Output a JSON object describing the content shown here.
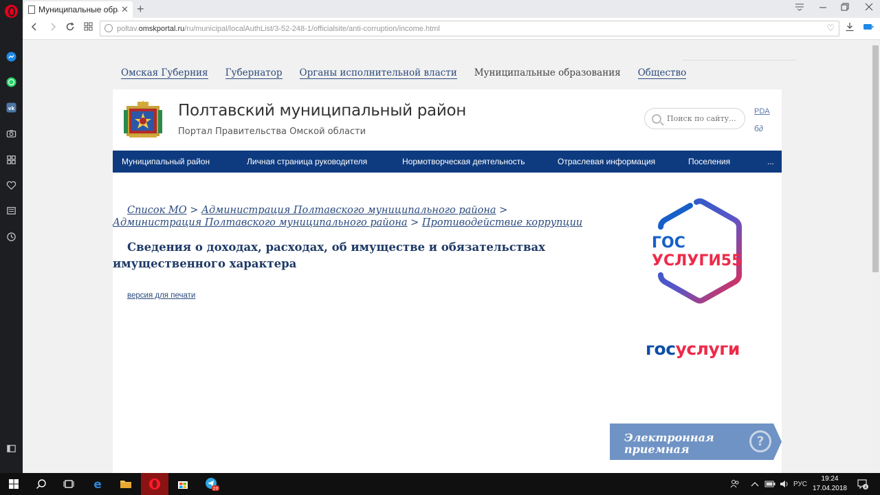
{
  "browser": {
    "tab_title": "Муниципальные образо",
    "url_prefix": "poltav.",
    "url_host": "omskportal.ru",
    "url_path": "/ru/municipal/localAuthList/3-52-248-1/officialsite/anti-corruption/income.html"
  },
  "top_nav": {
    "items": [
      {
        "label": "Омская Губерния"
      },
      {
        "label": "Губернатор"
      },
      {
        "label": "Органы исполнительной власти"
      },
      {
        "label": "Муниципальные образования"
      },
      {
        "label": "Общество"
      }
    ]
  },
  "header": {
    "title": "Полтавский муниципальный район",
    "subtitle": "Портал Правительства Омской области",
    "search_placeholder": "Поиск по сайту...",
    "pda_label": "PDA",
    "glasses_glyph": "б∂"
  },
  "main_menu": {
    "items": [
      {
        "label": "Муниципальный район"
      },
      {
        "label": "Личная страница руководителя"
      },
      {
        "label": "Нормотворческая деятельность"
      },
      {
        "label": "Отраслевая информация"
      },
      {
        "label": "Поселения"
      },
      {
        "label": "..."
      }
    ]
  },
  "breadcrumb": {
    "items": [
      {
        "label": "Список МО"
      },
      {
        "label": "Администрация Полтавского муниципального района"
      },
      {
        "label": "Администрация Полтавского муниципального района"
      },
      {
        "label": "Противодействие коррупции"
      }
    ],
    "separator": ">"
  },
  "page": {
    "heading": "Сведения о доходах, расходах, об имуществе и обязательствах имущественного характера",
    "print_link": "версия для печати"
  },
  "sidebar_banners": {
    "gos55_line1": "ГОС",
    "gos55_line2": "УСЛУГИ55",
    "gosuslugi_part1": "гос",
    "gosuslugi_part2": "услуги",
    "epriem_line1": "Электронная",
    "epriem_line2": "приемная",
    "epriem_icon": "?"
  },
  "taskbar": {
    "telegram_badge": "20",
    "lang": "РУС",
    "time": "19:24",
    "date": "17.04.2018",
    "notification_count": "4"
  },
  "colors": {
    "menu_bar": "#0e3b80",
    "link": "#2b4a7c",
    "gos_blue": "#0d4fa8",
    "gos_red": "#ee2a4a",
    "epriem_bg": "#6f93c4"
  }
}
